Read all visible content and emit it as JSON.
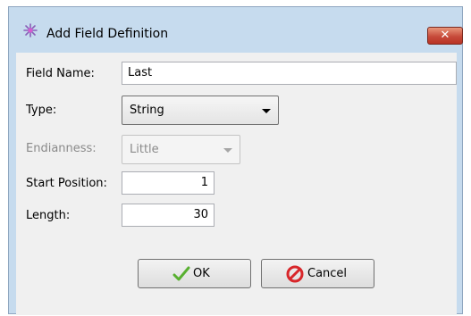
{
  "window": {
    "title": "Add Field Definition",
    "close_glyph": "✕"
  },
  "form": {
    "field_name_label": "Field Name:",
    "field_name_value": "Last",
    "type_label": "Type:",
    "type_value": "String",
    "endianness_label": "Endianness:",
    "endianness_value": "Little",
    "start_position_label": "Start Position:",
    "start_position_value": "1",
    "length_label": "Length:",
    "length_value": "30"
  },
  "buttons": {
    "ok_label": "OK",
    "cancel_label": "Cancel"
  },
  "icons": {
    "app": "sparkle-icon",
    "close": "close-icon",
    "ok": "checkmark-icon",
    "cancel": "cancel-icon"
  },
  "colors": {
    "title_bar": "#c6dbee",
    "close_button": "#c74b3b",
    "ok_check": "#58b030",
    "cancel_icon": "#d8262a"
  }
}
